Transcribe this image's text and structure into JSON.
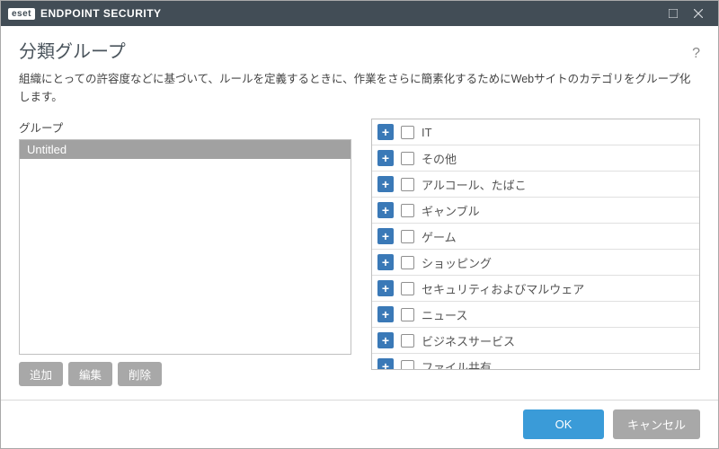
{
  "app": {
    "brand_short": "eset",
    "product_name": "ENDPOINT SECURITY"
  },
  "dialog": {
    "title": "分類グループ",
    "description": "組織にとっての許容度などに基づいて、ルールを定義するときに、作業をさらに簡素化するためにWebサイトのカテゴリをグループ化します。"
  },
  "groups": {
    "label": "グループ",
    "items": [
      "Untitled"
    ],
    "buttons": {
      "add": "追加",
      "edit": "編集",
      "delete": "削除"
    }
  },
  "categories": [
    "IT",
    "その他",
    "アルコール、たばこ",
    "ギャンブル",
    "ゲーム",
    "ショッピング",
    "セキュリティおよびマルウェア",
    "ニュース",
    "ビジネスサービス",
    "ファイル共有"
  ],
  "footer": {
    "ok": "OK",
    "cancel": "キャンセル"
  },
  "help_symbol": "?"
}
